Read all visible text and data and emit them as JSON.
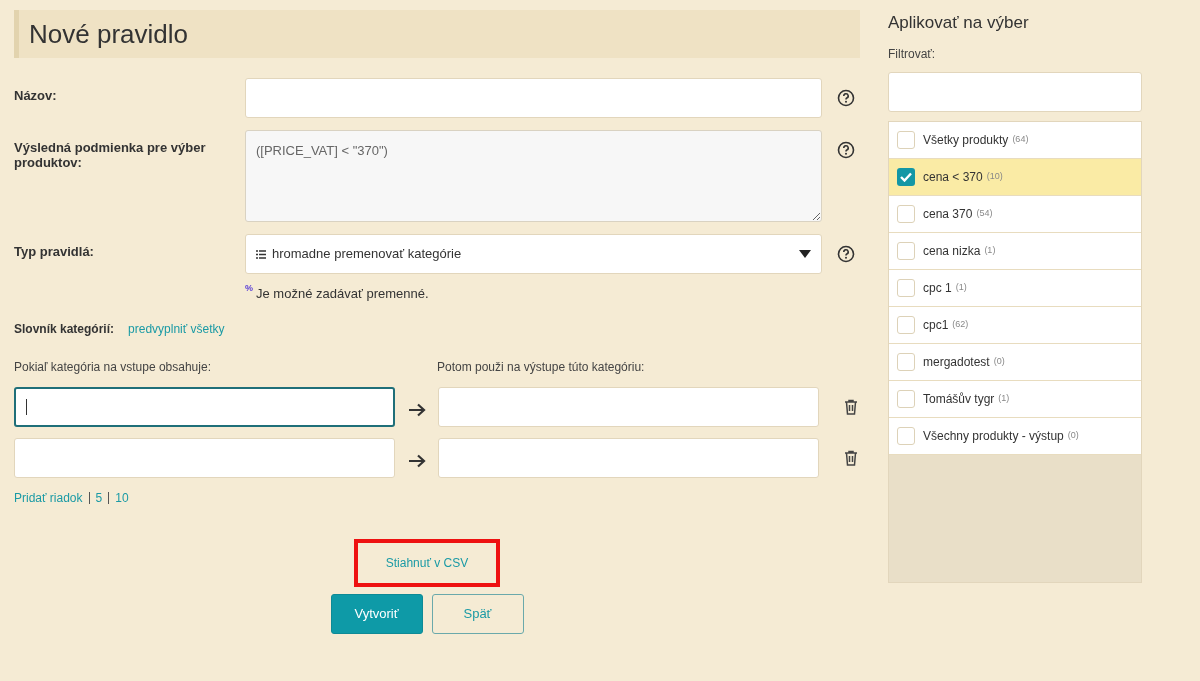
{
  "heading": "Nové pravidlo",
  "fields": [
    {
      "kind": "input",
      "label": "Názov:"
    },
    {
      "kind": "textarea",
      "label": "Výsledná podmienka pre výber produktov:",
      "value": "([PRICE_VAT] < \"370\")"
    },
    {
      "kind": "select",
      "label": "Typ pravidlá:",
      "value": "hromadne premenovať kategórie"
    }
  ],
  "variables_hint": {
    "mark": "%",
    "text": "Je možné zadávať premenné."
  },
  "dictionary": {
    "label": "Slovník kategórií:",
    "link": "predvyplniť všetky"
  },
  "mapping": {
    "input_heading": "Pokiaľ kategória na vstupe obsahuje:",
    "output_heading": "Potom použi na výstupe túto kategóriu:",
    "rows": [
      {
        "focused": true
      },
      {
        "focused": false
      }
    ],
    "add_links": [
      "Pridať riadok",
      "5",
      "10"
    ]
  },
  "csv_link": {
    "label": "Stiahnuť v CSV",
    "highlighted": true
  },
  "buttons": [
    {
      "label": "Vytvoriť",
      "kind": "primary"
    },
    {
      "label": "Späť",
      "kind": "secondary"
    }
  ],
  "sidebar": {
    "title": "Aplikovať na výber",
    "filter_label": "Filtrovať:",
    "items": [
      {
        "label": "Všetky produkty",
        "count": "(64)",
        "checked": false
      },
      {
        "label": "cena < 370",
        "count": "(10)",
        "checked": true
      },
      {
        "label": "cena 370",
        "count": "(54)",
        "checked": false
      },
      {
        "label": "cena nizka",
        "count": "(1)",
        "checked": false
      },
      {
        "label": "cpc 1",
        "count": "(1)",
        "checked": false
      },
      {
        "label": "cpc1",
        "count": "(62)",
        "checked": false
      },
      {
        "label": "mergadotest",
        "count": "(0)",
        "checked": false
      },
      {
        "label": "Tomášův tygr",
        "count": "(1)",
        "checked": false
      },
      {
        "label": "Všechny produkty - výstup",
        "count": "(0)",
        "checked": false
      }
    ]
  }
}
